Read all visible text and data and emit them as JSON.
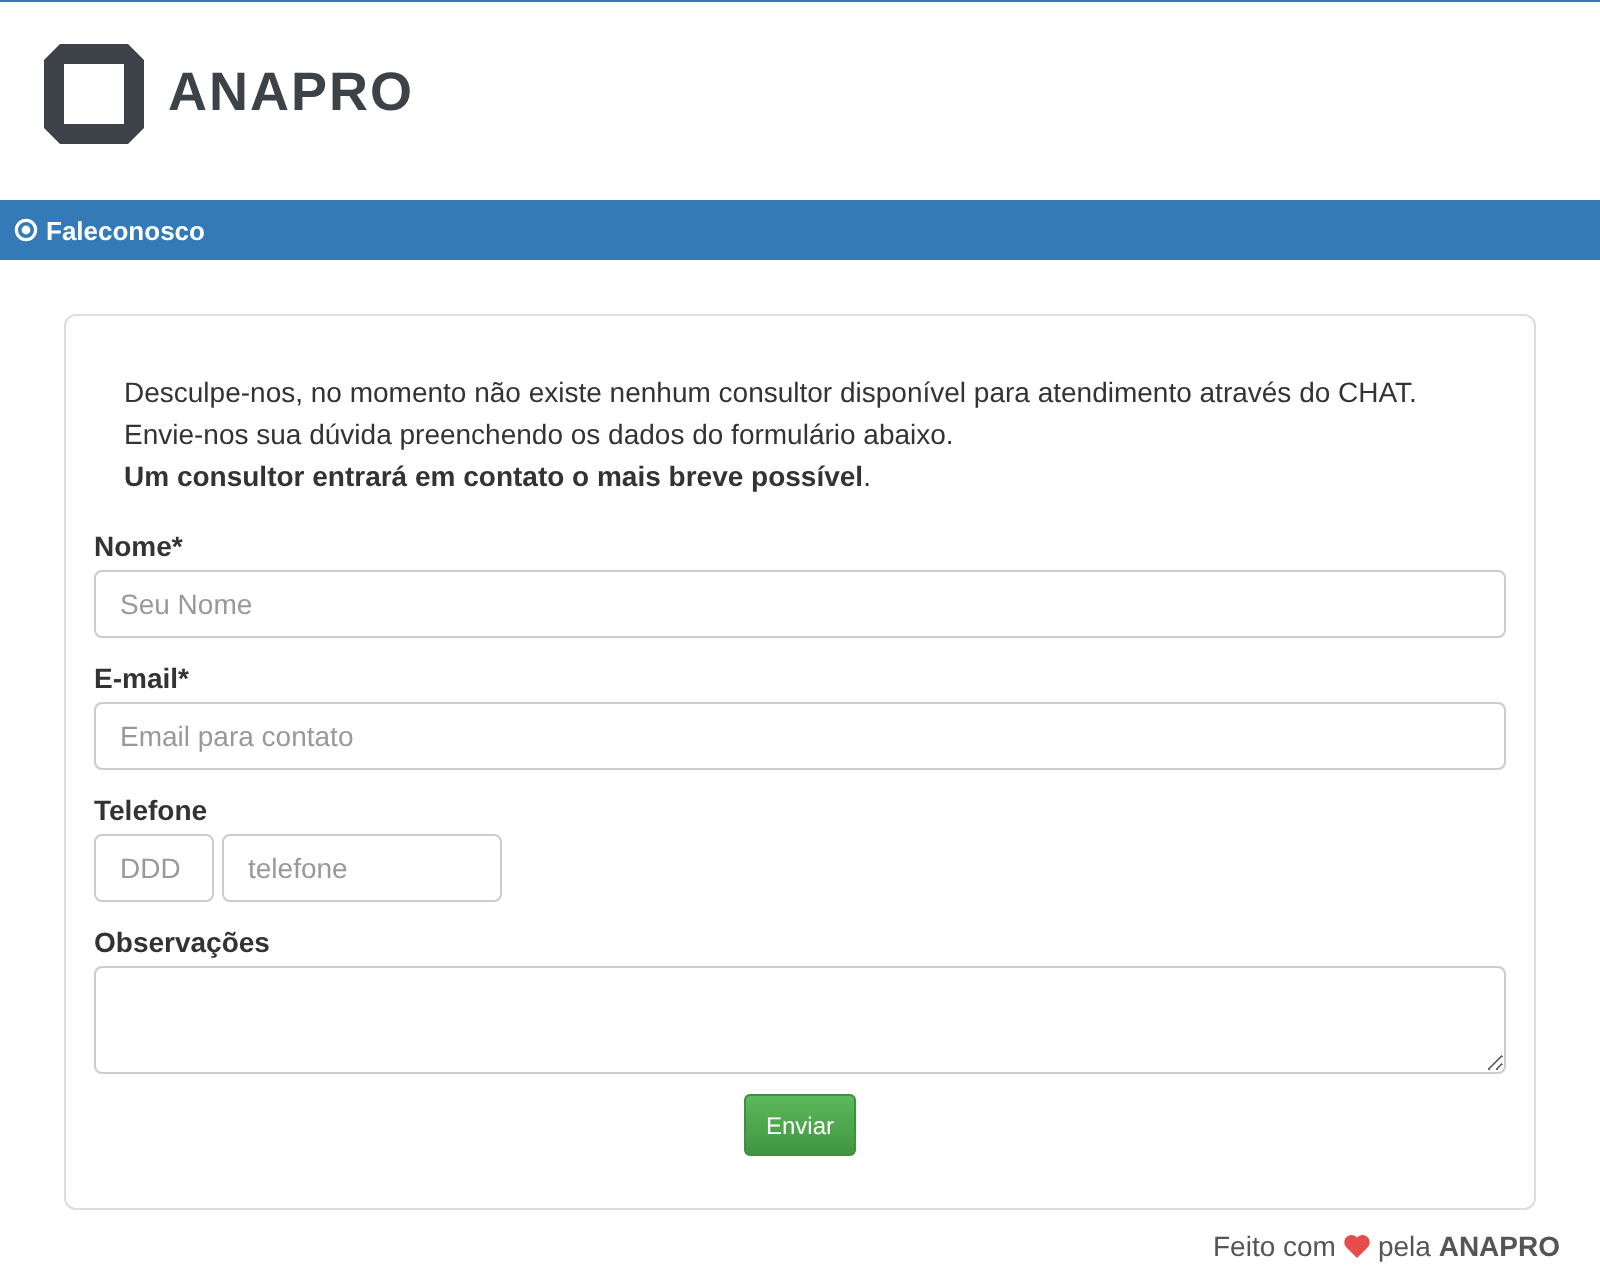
{
  "logo": {
    "text": "ANAPRO"
  },
  "section_bar": {
    "title": "Faleconosco"
  },
  "message": [
    "Desculpe-nos, no momento não existe nenhum consultor disponível para atendimento através do CHAT.",
    "Envie-nos sua dúvida preenchendo os dados do formulário abaixo.",
    "**Um consultor entrará em contato o mais breve possível**."
  ],
  "fields": [
    {
      "kind": "text",
      "label": "Nome*",
      "placeholder": "Seu Nome"
    },
    {
      "kind": "text",
      "label": "E-mail*",
      "placeholder": "Email para contato"
    },
    {
      "kind": "phone",
      "label": "Telefone",
      "placeholders": [
        "DDD",
        "telefone"
      ]
    },
    {
      "kind": "textarea",
      "label": "Observações"
    }
  ],
  "submit_button": "Enviar",
  "footer": {
    "before": "Feito com",
    "after": "pela **ANAPRO**"
  }
}
